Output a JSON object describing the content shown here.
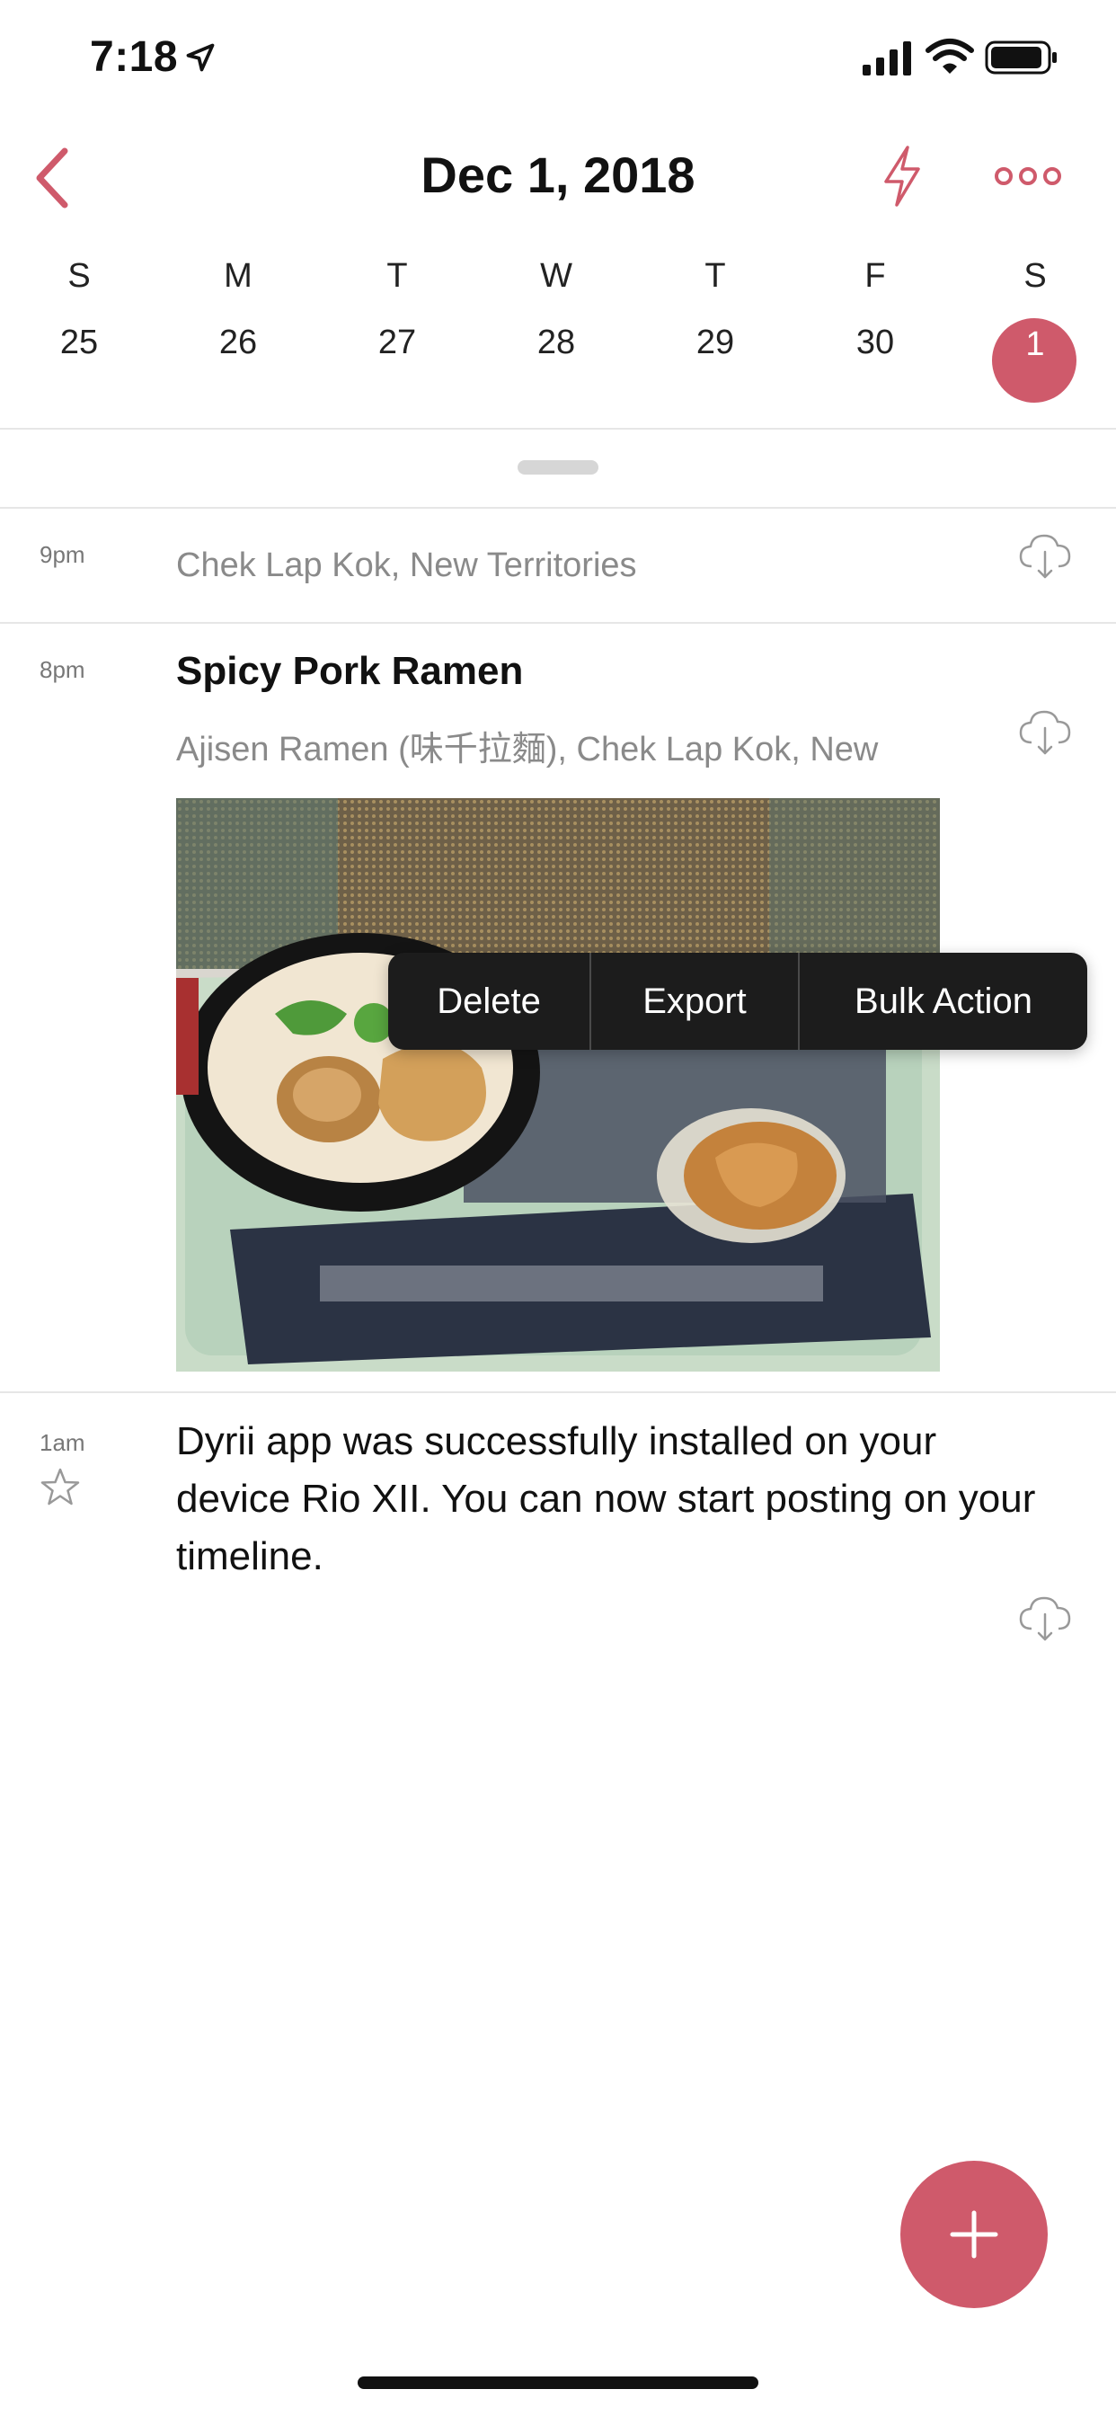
{
  "status": {
    "time": "7:18"
  },
  "header": {
    "title": "Dec 1, 2018"
  },
  "week": [
    {
      "dow": "S",
      "num": "25",
      "selected": false
    },
    {
      "dow": "M",
      "num": "26",
      "selected": false
    },
    {
      "dow": "T",
      "num": "27",
      "selected": false
    },
    {
      "dow": "W",
      "num": "28",
      "selected": false
    },
    {
      "dow": "T",
      "num": "29",
      "selected": false
    },
    {
      "dow": "F",
      "num": "30",
      "selected": false
    },
    {
      "dow": "S",
      "num": "1",
      "selected": true
    }
  ],
  "entries": [
    {
      "time": "9pm",
      "location": "Chek Lap Kok, New Territories"
    },
    {
      "time": "8pm",
      "title": "Spicy Pork Ramen",
      "location": "Ajisen Ramen (味千拉麵), Chek Lap Kok, New"
    },
    {
      "time": "1am",
      "body": "Dyrii app was successfully installed on your device Rio XII. You can now start posting on your timeline."
    }
  ],
  "context_menu": {
    "delete": "Delete",
    "export": "Export",
    "bulk": "Bulk Action"
  },
  "colors": {
    "accent": "#cf5a6b"
  }
}
